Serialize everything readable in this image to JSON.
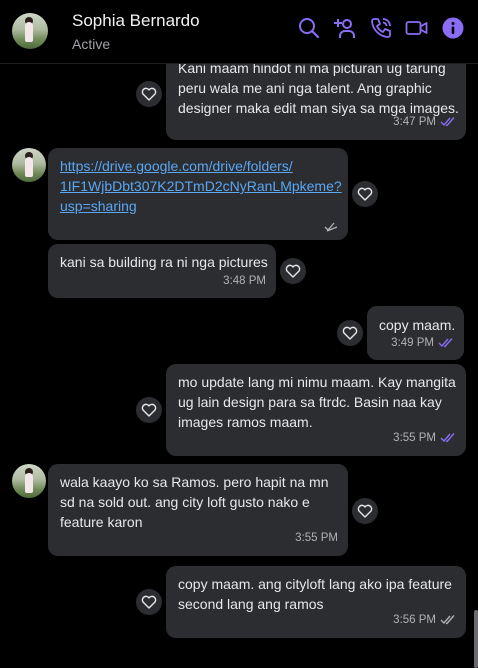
{
  "header": {
    "name": "Sophia Bernardo",
    "status": "Active"
  },
  "colors": {
    "accent": "#8b6cf5",
    "bubble": "#2c2d31",
    "link": "#5aa7f4"
  },
  "messages": [
    {
      "sender": "me",
      "text": "Kani maam hindot ni ma picturan ug tarung\nperu wala me ani nga talent. Ang graphic\ndesigner maka edit man siya sa mga images.",
      "time": "3:47 PM",
      "status_icon": "double-check-icon"
    },
    {
      "sender": "contact",
      "link": "https://drive.google.com/drive/folders/\n1IF1WjbDbt307K2DTmD2cNyRanLMpkeme?\nusp=sharing",
      "status_icon": "sent-icon"
    },
    {
      "sender": "contact",
      "text": "kani sa building ra ni nga pictures",
      "time": "3:48 PM"
    },
    {
      "sender": "me",
      "text": "copy maam.",
      "time": "3:49 PM",
      "status_icon": "double-check-icon"
    },
    {
      "sender": "me",
      "text": "mo update lang mi nimu maam. Kay mangita\nug lain design para sa ftrdc. Basin naa kay\nimages ramos maam.",
      "time": "3:55 PM",
      "status_icon": "double-check-icon"
    },
    {
      "sender": "contact",
      "text": "wala kaayo ko sa Ramos. pero hapit na mn\nsd na sold out. ang city loft gusto nako e\nfeature karon",
      "time": "3:55 PM"
    },
    {
      "sender": "me",
      "text": "copy maam. ang cityloft lang ako ipa feature\nsecond lang ang ramos",
      "time": "3:56 PM",
      "status_icon": "double-check-icon"
    }
  ]
}
